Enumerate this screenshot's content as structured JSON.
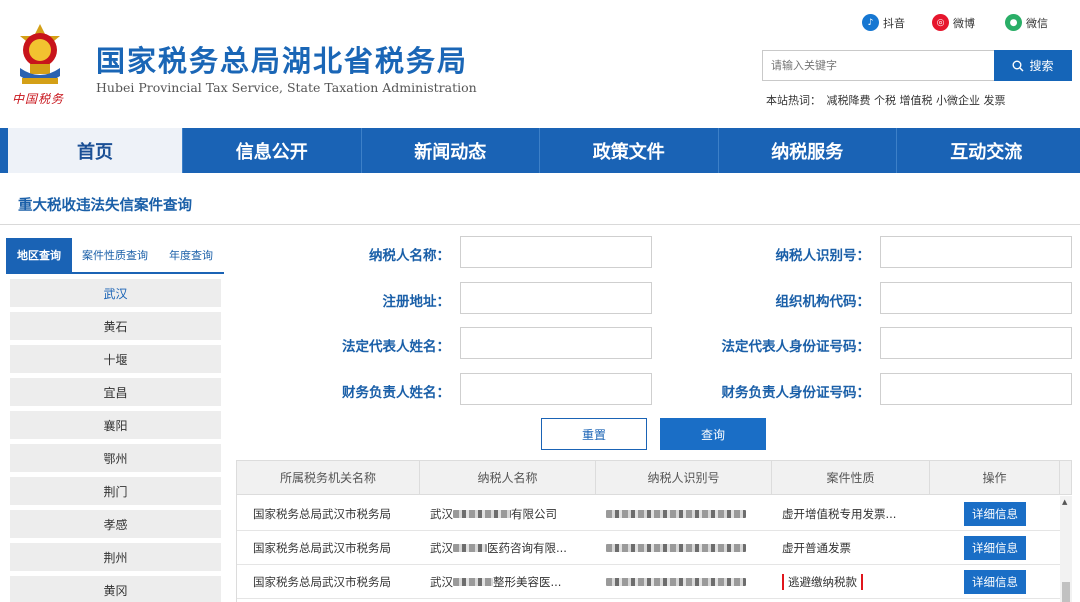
{
  "header": {
    "title": "国家税务总局湖北省税务局",
    "subtitle": "Hubei Provincial Tax Service, State Taxation Administration",
    "seal_text": "中国税务",
    "social": [
      {
        "label": "抖音",
        "icon": "douyin-icon",
        "color": "#1677d2"
      },
      {
        "label": "微博",
        "icon": "weibo-icon",
        "color": "#e6162d"
      },
      {
        "label": "微信",
        "icon": "wechat-icon",
        "color": "#2aae67"
      }
    ],
    "search": {
      "placeholder": "请输入关键字",
      "button_label": "搜索"
    },
    "hot": {
      "label": "本站热词：",
      "terms": "减税降费 个税 增值税 小微企业 发票"
    }
  },
  "nav": [
    "首页",
    "信息公开",
    "新闻动态",
    "政策文件",
    "纳税服务",
    "互动交流"
  ],
  "page_title": "重大税收违法失信案件查询",
  "side_tabs": [
    "地区查询",
    "案件性质查询",
    "年度查询"
  ],
  "regions": [
    "武汉",
    "黄石",
    "十堰",
    "宜昌",
    "襄阳",
    "鄂州",
    "荆门",
    "孝感",
    "荆州",
    "黄冈"
  ],
  "form": {
    "taxpayer_name": "纳税人名称：",
    "taxpayer_id": "纳税人识别号：",
    "address": "注册地址：",
    "org_code": "组织机构代码：",
    "legal_rep": "法定代表人姓名：",
    "legal_rep_id": "法定代表人身份证号码：",
    "finance_head": "财务负责人姓名：",
    "finance_head_id": "财务负责人身份证号码：",
    "reset": "重置",
    "query": "查询"
  },
  "table": {
    "columns": [
      "所属税务机关名称",
      "纳税人名称",
      "纳税人识别号",
      "案件性质",
      "操作"
    ],
    "rows": [
      {
        "org": "国家税务总局武汉市税务局",
        "name_prefix": "武汉",
        "name_suffix": "有限公司",
        "nature": "虚开增值税专用发票...",
        "action": "详细信息"
      },
      {
        "org": "国家税务总局武汉市税务局",
        "name_prefix": "武汉",
        "name_suffix": "医药咨询有限...",
        "nature": "虚开普通发票",
        "action": "详细信息"
      },
      {
        "org": "国家税务总局武汉市税务局",
        "name_prefix": "武汉",
        "name_suffix": "整形美容医...",
        "nature": "逃避缴纳税款",
        "action": "详细信息"
      }
    ]
  },
  "colors": {
    "brand_blue": "#1a63b5",
    "highlight_red": "#e0161c"
  }
}
